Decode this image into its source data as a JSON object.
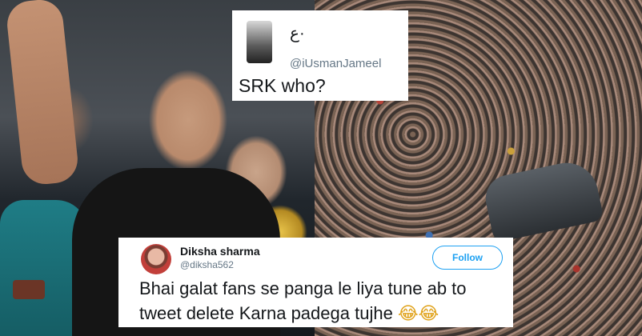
{
  "tweet_top": {
    "display_name": "ع·",
    "handle": "@iUsmanJameel",
    "text": "SRK who?"
  },
  "tweet_bottom": {
    "display_name": "Diksha sharma",
    "handle": "@diksha562",
    "follow_label": "Follow",
    "text_line1": "Bhai galat fans se panga le liya tune ab to",
    "text_line2": "tweet delete Karna padega tujhe",
    "emoji": "😂😂"
  },
  "colors": {
    "follow_accent": "#1da1f2",
    "handle_gray": "#657786"
  }
}
